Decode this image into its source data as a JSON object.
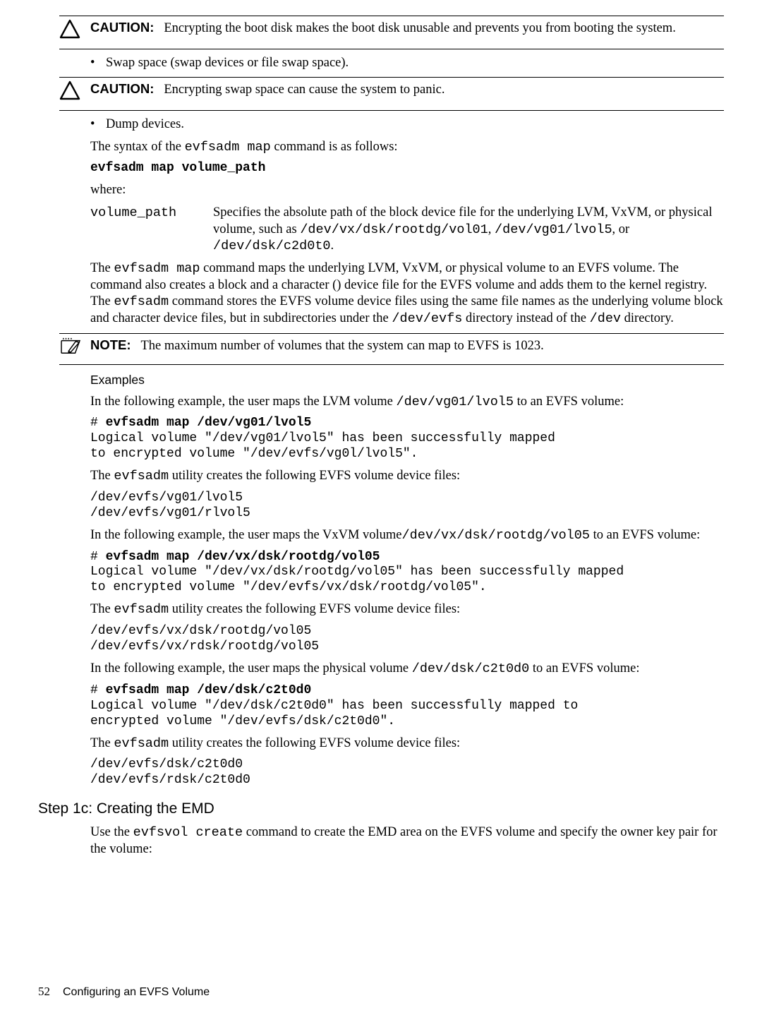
{
  "callout1": {
    "label": "CAUTION:",
    "text": "Encrypting the boot disk makes the boot disk unusable and prevents you from booting the system."
  },
  "bullet_swap": "Swap space (swap devices or file swap space).",
  "callout2": {
    "label": "CAUTION:",
    "text": "Encrypting swap space can cause the system to panic."
  },
  "bullet_dump": "Dump devices.",
  "syntax_intro_a": "The syntax of the ",
  "syntax_intro_cmd": "evfsadm map",
  "syntax_intro_b": " command is as follows:",
  "syntax_cmd": "evfsadm map volume_path",
  "where": "where:",
  "def": {
    "term": "volume_path",
    "body_a": "Specifies the absolute path of the block device file for the underlying LVM, VxVM, or physical volume, such as ",
    "mono1": "/dev/vx/dsk/rootdg/vol01",
    "sep1": ", ",
    "mono2": "/dev/vg01/lvol5",
    "sep2": ", or ",
    "mono3": "/dev/dsk/c2d0t0",
    "end": "."
  },
  "mappara_a": "The ",
  "mappara_cmd": "evfsadm map",
  "mappara_b": " command maps the underlying LVM, VxVM, or physical volume to an EVFS volume. The command also creates a block and a character () device file for the EVFS volume and adds them to the kernel registry. The ",
  "mappara_cmd2": "evfsadm",
  "mappara_c": " command stores the EVFS volume device files using the same file names as the underlying volume block and character device files, but in subdirectories under the ",
  "mappara_mono1": "/dev/evfs",
  "mappara_d": " directory instead of the ",
  "mappara_mono2": "/dev",
  "mappara_e": " directory.",
  "note": {
    "label": "NOTE:",
    "text": "The maximum number of volumes that the system can map to EVFS is 1023."
  },
  "examples_heading": "Examples",
  "ex1_a": "In the following example, the user maps the LVM volume ",
  "ex1_mono": "/dev/vg01/lvol5",
  "ex1_b": " to an EVFS volume:",
  "ex1_cmd": "evfsadm map /dev/vg01/lvol5",
  "ex1_out": "Logical volume \"/dev/vg01/lvol5\" has been successfully mapped\nto encrypted volume \"/dev/evfs/vg0l/lvol5\".",
  "ex1_util_a": "The ",
  "ex1_util_cmd": "evfsadm",
  "ex1_util_b": " utility creates the following EVFS volume device files:",
  "ex1_files": "/dev/evfs/vg01/lvol5\n/dev/evfs/vg01/rlvol5",
  "ex2_a": "In the following example, the user maps the VxVM volume",
  "ex2_mono": "/dev/vx/dsk/rootdg/vol05",
  "ex2_b": " to an EVFS volume:",
  "ex2_cmd": "evfsadm map /dev/vx/dsk/rootdg/vol05",
  "ex2_out": "Logical volume \"/dev/vx/dsk/rootdg/vol05\" has been successfully mapped\nto encrypted volume \"/dev/evfs/vx/dsk/rootdg/vol05\".",
  "ex2_util_a": "The ",
  "ex2_util_cmd": "evfsadm",
  "ex2_util_b": " utility creates the following EVFS volume device files:",
  "ex2_files": "/dev/evfs/vx/dsk/rootdg/vol05\n/dev/evfs/vx/rdsk/rootdg/vol05",
  "ex3_a": "In the following example, the user maps the physical volume ",
  "ex3_mono": "/dev/dsk/c2t0d0",
  "ex3_b": " to an EVFS volume:",
  "ex3_cmd": "evfsadm map /dev/dsk/c2t0d0",
  "ex3_out": "Logical volume \"/dev/dsk/c2t0d0\" has been successfully mapped to\nencrypted volume \"/dev/evfs/dsk/c2t0d0\".",
  "ex3_util_a": "The ",
  "ex3_util_cmd": "evfsadm",
  "ex3_util_b": " utility creates the following EVFS volume device files:",
  "ex3_files": "/dev/evfs/dsk/c2t0d0\n/dev/evfs/rdsk/c2t0d0",
  "step_heading": "Step 1c: Creating the EMD",
  "step_a": "Use the ",
  "step_cmd": "evfsvol create",
  "step_b": " command to create the EMD area on the EVFS volume and specify the owner key pair for the volume:",
  "footer": {
    "page": "52",
    "title": "Configuring an EVFS Volume"
  }
}
